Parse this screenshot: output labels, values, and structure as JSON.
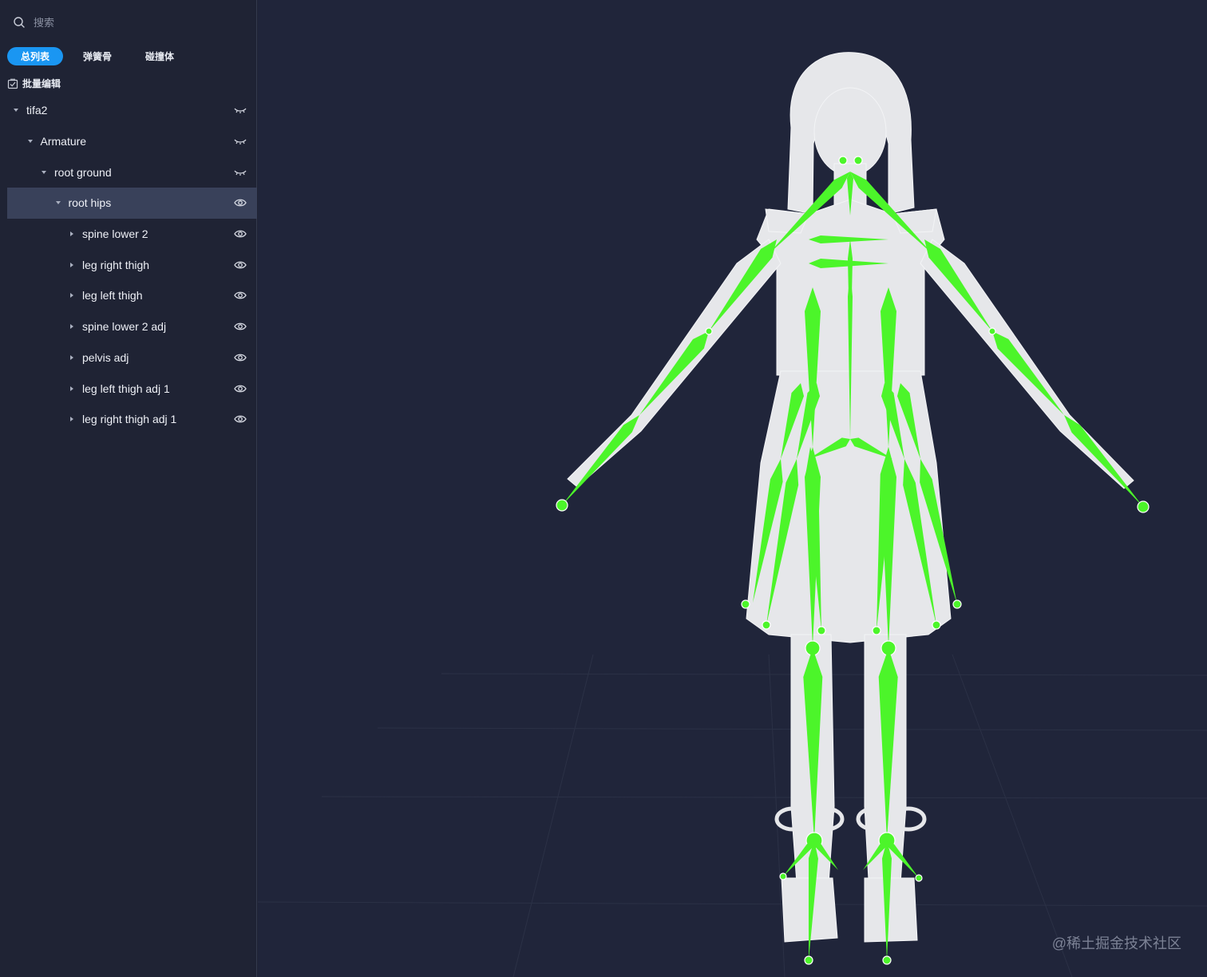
{
  "search": {
    "placeholder": "搜索"
  },
  "tabs": [
    {
      "label": "总列表",
      "active": true
    },
    {
      "label": "弹簧骨",
      "active": false
    },
    {
      "label": "碰撞体",
      "active": false
    }
  ],
  "batch_edit": {
    "label": "批量编辑"
  },
  "tree": [
    {
      "label": "tifa2",
      "depth": 0,
      "expanded": true,
      "visibility": "hidden",
      "selected": false
    },
    {
      "label": "Armature",
      "depth": 1,
      "expanded": true,
      "visibility": "hidden",
      "selected": false
    },
    {
      "label": "root ground",
      "depth": 2,
      "expanded": true,
      "visibility": "hidden",
      "selected": false
    },
    {
      "label": "root hips",
      "depth": 3,
      "expanded": true,
      "visibility": "visible",
      "selected": true
    },
    {
      "label": "spine lower 2",
      "depth": 4,
      "expanded": false,
      "visibility": "visible",
      "selected": false
    },
    {
      "label": "leg right thigh",
      "depth": 4,
      "expanded": false,
      "visibility": "visible",
      "selected": false
    },
    {
      "label": "leg left thigh",
      "depth": 4,
      "expanded": false,
      "visibility": "visible",
      "selected": false
    },
    {
      "label": "spine lower 2 adj",
      "depth": 4,
      "expanded": false,
      "visibility": "visible",
      "selected": false
    },
    {
      "label": "pelvis adj",
      "depth": 4,
      "expanded": false,
      "visibility": "visible",
      "selected": false
    },
    {
      "label": "leg left thigh adj 1",
      "depth": 4,
      "expanded": false,
      "visibility": "visible",
      "selected": false
    },
    {
      "label": "leg right thigh adj 1",
      "depth": 4,
      "expanded": false,
      "visibility": "visible",
      "selected": false
    }
  ],
  "viewport": {
    "watermark": "@稀土掘金技术社区",
    "bone_color": "#4cf52a",
    "model_color": "#e6e7ea",
    "background": "#20253a"
  },
  "colors": {
    "accent": "#1a96f2",
    "selected_row": "#39415a",
    "sidebar_bg": "#1f2334"
  }
}
